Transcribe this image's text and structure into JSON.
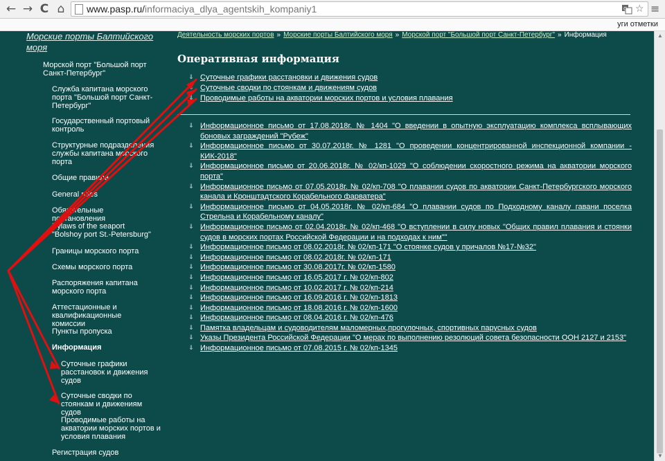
{
  "browser": {
    "back_icon": "←",
    "forward_icon": "→",
    "reload_icon": "C",
    "home_icon": "⌂",
    "url_host": "www.pasp.ru/",
    "url_path": "informaciya_dlya_agentskih_kompaniy1",
    "translate_icon": "translate-icon",
    "star_icon": "☆",
    "menu_icon": "≡",
    "bookmarks_text": "уги отметки"
  },
  "sidebar": {
    "top_link": "Морские порты Балтийского моря",
    "port": "Морской порт \"Большой порт Санкт-Петербург\"",
    "items": [
      "Служба капитана морского порта \"Большой порт Санкт-Петербург\"",
      "Государственный портовый контроль",
      "Структурные подразделения службы капитана морского порта",
      "Общие правила",
      "General rules",
      "Обязательные постановления",
      "Bylaws of the seaport \"Bolshoy port St.-Petersburg\"",
      "Границы морского порта",
      "Схемы морского порта",
      "Распоряжения капитана морского порта",
      "Аттестационные и квалификационные комиссии",
      "Пункты пропуска",
      "Информация"
    ],
    "subitems": [
      "Суточные графики расстановок и движения судов",
      "Суточные сводки по стоянкам и движениям судов",
      "Проводимые работы на акватории морских портов и условия плавания"
    ],
    "last_item": "Регистрация судов"
  },
  "breadcrumb": {
    "items": [
      "Деятельность морских портов",
      "Морские порты Балтийского моря",
      "Морской порт \"Большой порт Санкт-Петербург\"",
      "Информация"
    ],
    "separator": "»"
  },
  "main": {
    "title": "Оперативная информация",
    "top_links": [
      "Суточные графики расстановки и движения судов",
      "Суточные сводки по стоянкам и движениям судов",
      "Проводимые работы на акватории морских портов и условия плавания"
    ],
    "letters": [
      "Информационное письмо от 17.08.2018г. № 1404 \"О введении в опытную эксплуатацию комплекса всплывающих боновых заграждений \"Рубеж\"",
      "Информационное письмо от 30.07.2018г. № 1281 \"О проведении концентрированной инспекционной компании - КИК-2018\"",
      "Информационное письмо от 20.06.2018г. № 02/кп-1029 \"О соблюдении скоростного режима на акватории морского порта\"",
      "Информационное письмо от 07.05.2018г. № 02/кп-708 \"О плавании судов по акватории Санкт-Петербургского морского канала и Кронштадтского Корабельного фарватера\"",
      "Информационное письмо от 04.05.2018г. № 02/кп-684 \"О плавании судов по Подходному каналу гавани поселка Стрельна и Корабельному каналу\"",
      "Информационное письмо от 02.04.2018г. № 02/кп-468 \"О вступлении в силу новых \"Общих правил плавания и стоянки судов в морских портах Российской Федерации и на подходах к ним\"\"",
      "Информационное письмо от 08.02.2018г. № 02/кп-171 \"О стоянке судов у причалов №17-№32\"",
      "Информационное письмо от 08.02.2018г. № 02/кп-171",
      "Информационное письмо от 30.08.2017г. № 02/кп-1580",
      "Информационное письмо от 16.05.2017 г. № 02/кп-802",
      "Информационное письмо от 10.02.2017 г. № 02/кп-214",
      "Информационное письмо от 16.09.2016 г. № 02/кп-1813",
      "Информационное письмо от 18.08.2016 г. № 02/кп-1600",
      "Информационное письмо от 08.04.2016 г. № 02/кп-476",
      "Памятка владельцам и судоводителям маломерных,прогулочных, спортивных парусных судов",
      "Указы Президента Российской Федерации \"О мерах по выполнению резолюций совета безопасности ООН 2127 и 2153\"",
      "Информационное письмо от 07.08.2015 г. № 02/кп-1345"
    ]
  },
  "colors": {
    "background": "#0d4a4a",
    "text": "#ffffff",
    "annotation_arrow": "#e01010"
  }
}
